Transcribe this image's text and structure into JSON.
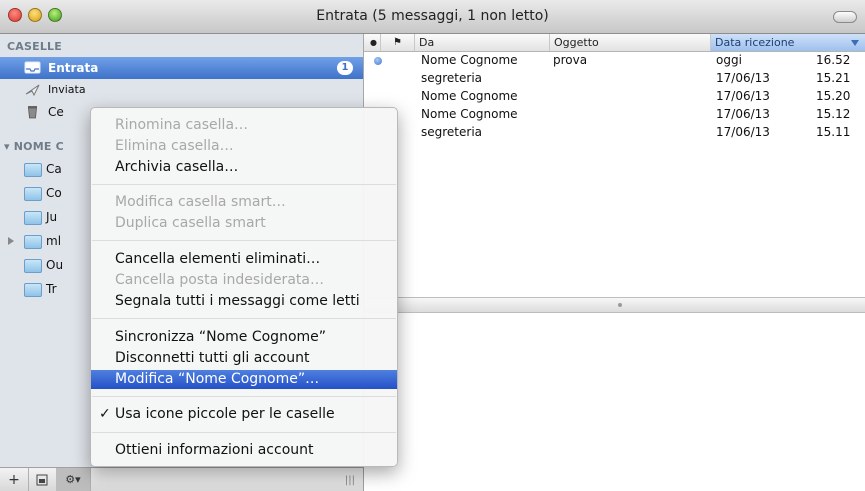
{
  "window": {
    "title": "Entrata (5 messaggi, 1 non letto)"
  },
  "sidebar": {
    "section_mailboxes": "CASELLE",
    "items": [
      {
        "label": "Entrata",
        "badge": "1"
      },
      {
        "label": "Inviata"
      },
      {
        "label": "Ce"
      }
    ],
    "section_account": "NOME C",
    "account_folders": [
      {
        "label": "Ca"
      },
      {
        "label": "Co"
      },
      {
        "label": "Ju"
      },
      {
        "label": "ml"
      },
      {
        "label": "Ou"
      },
      {
        "label": "Tr"
      }
    ]
  },
  "bottom_bar": {
    "add": "+",
    "gear": "⚙▾",
    "grip": "|||"
  },
  "message_list": {
    "headers": {
      "flag": "●",
      "attachment": "⚑",
      "from": "Da",
      "subject": "Oggetto",
      "date": "Data ricezione"
    },
    "rows": [
      {
        "unread": true,
        "from": "Nome Cognome",
        "subject": "prova",
        "date": "oggi",
        "time": "16.52"
      },
      {
        "unread": false,
        "from": "segreteria",
        "subject": "",
        "date": "17/06/13",
        "time": "15.21"
      },
      {
        "unread": false,
        "from": "Nome Cognome",
        "subject": "",
        "date": "17/06/13",
        "time": "15.20"
      },
      {
        "unread": false,
        "from": "Nome Cognome",
        "subject": "",
        "date": "17/06/13",
        "time": "15.12"
      },
      {
        "unread": false,
        "from": "segreteria",
        "subject": "",
        "date": "17/06/13",
        "time": "15.11"
      }
    ]
  },
  "context_menu": {
    "items": [
      {
        "label": "Rinomina casella…",
        "enabled": false
      },
      {
        "label": "Elimina casella…",
        "enabled": false
      },
      {
        "label": "Archivia casella…",
        "enabled": true
      },
      {
        "label": "Modifica casella smart…",
        "enabled": false
      },
      {
        "label": "Duplica casella smart",
        "enabled": false
      },
      {
        "label": "Cancella elementi eliminati…",
        "enabled": true
      },
      {
        "label": "Cancella posta indesiderata…",
        "enabled": false
      },
      {
        "label": "Segnala tutti i messaggi come letti",
        "enabled": true
      },
      {
        "label": "Sincronizza “Nome Cognome”",
        "enabled": true
      },
      {
        "label": "Disconnetti tutti gli account",
        "enabled": true
      },
      {
        "label": "Modifica “Nome Cognome”…",
        "enabled": true,
        "highlighted": true
      },
      {
        "label": "Usa icone piccole per le caselle",
        "enabled": true,
        "checked": true,
        "check_mark": "✓"
      },
      {
        "label": "Ottieni informazioni account",
        "enabled": true
      }
    ]
  },
  "colors": {
    "selection": "#3f73c9",
    "menu_highlight": "#2451c7",
    "sidebar_bg": "#dfe4ea"
  }
}
